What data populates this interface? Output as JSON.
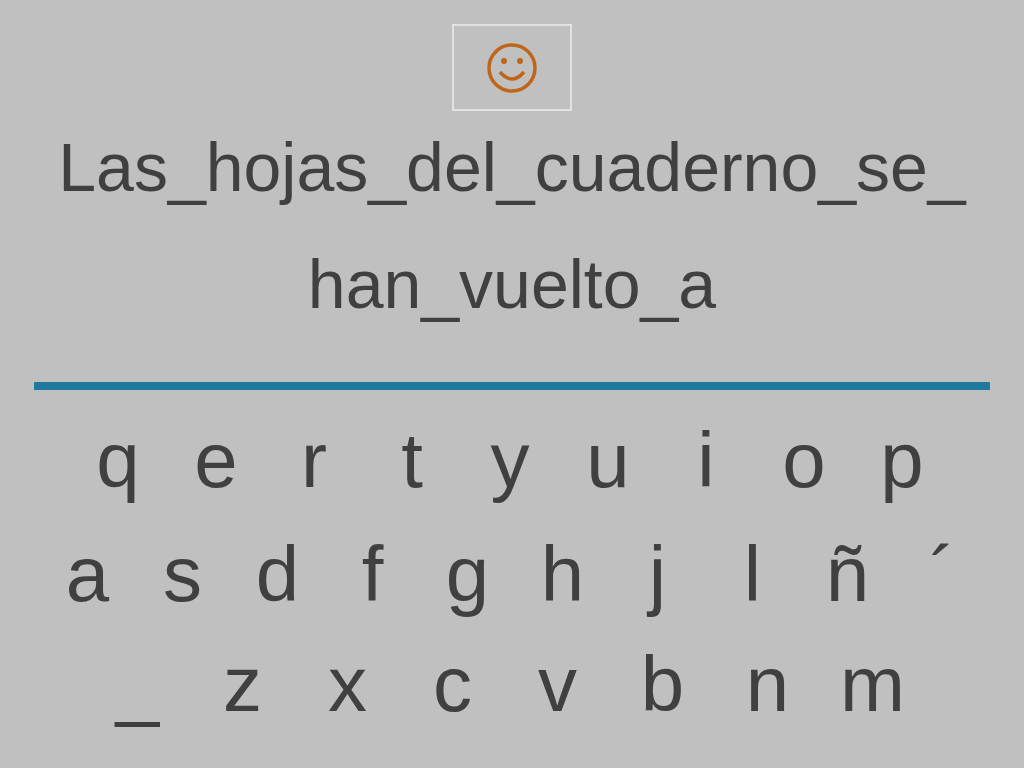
{
  "feedback": {
    "kind": "smiley"
  },
  "sentence": [
    "Las_hojas_del_cuaderno_se_",
    "han_vuelto_a"
  ],
  "keyboard": [
    [
      "q",
      "e",
      "r",
      "t",
      "y",
      "u",
      "i",
      "o",
      "p"
    ],
    [
      "a",
      "s",
      "d",
      "f",
      "g",
      "h",
      "j",
      "l",
      "ñ",
      "´"
    ],
    [
      "_",
      "z",
      "x",
      "c",
      "v",
      "b",
      "n",
      "m"
    ]
  ]
}
